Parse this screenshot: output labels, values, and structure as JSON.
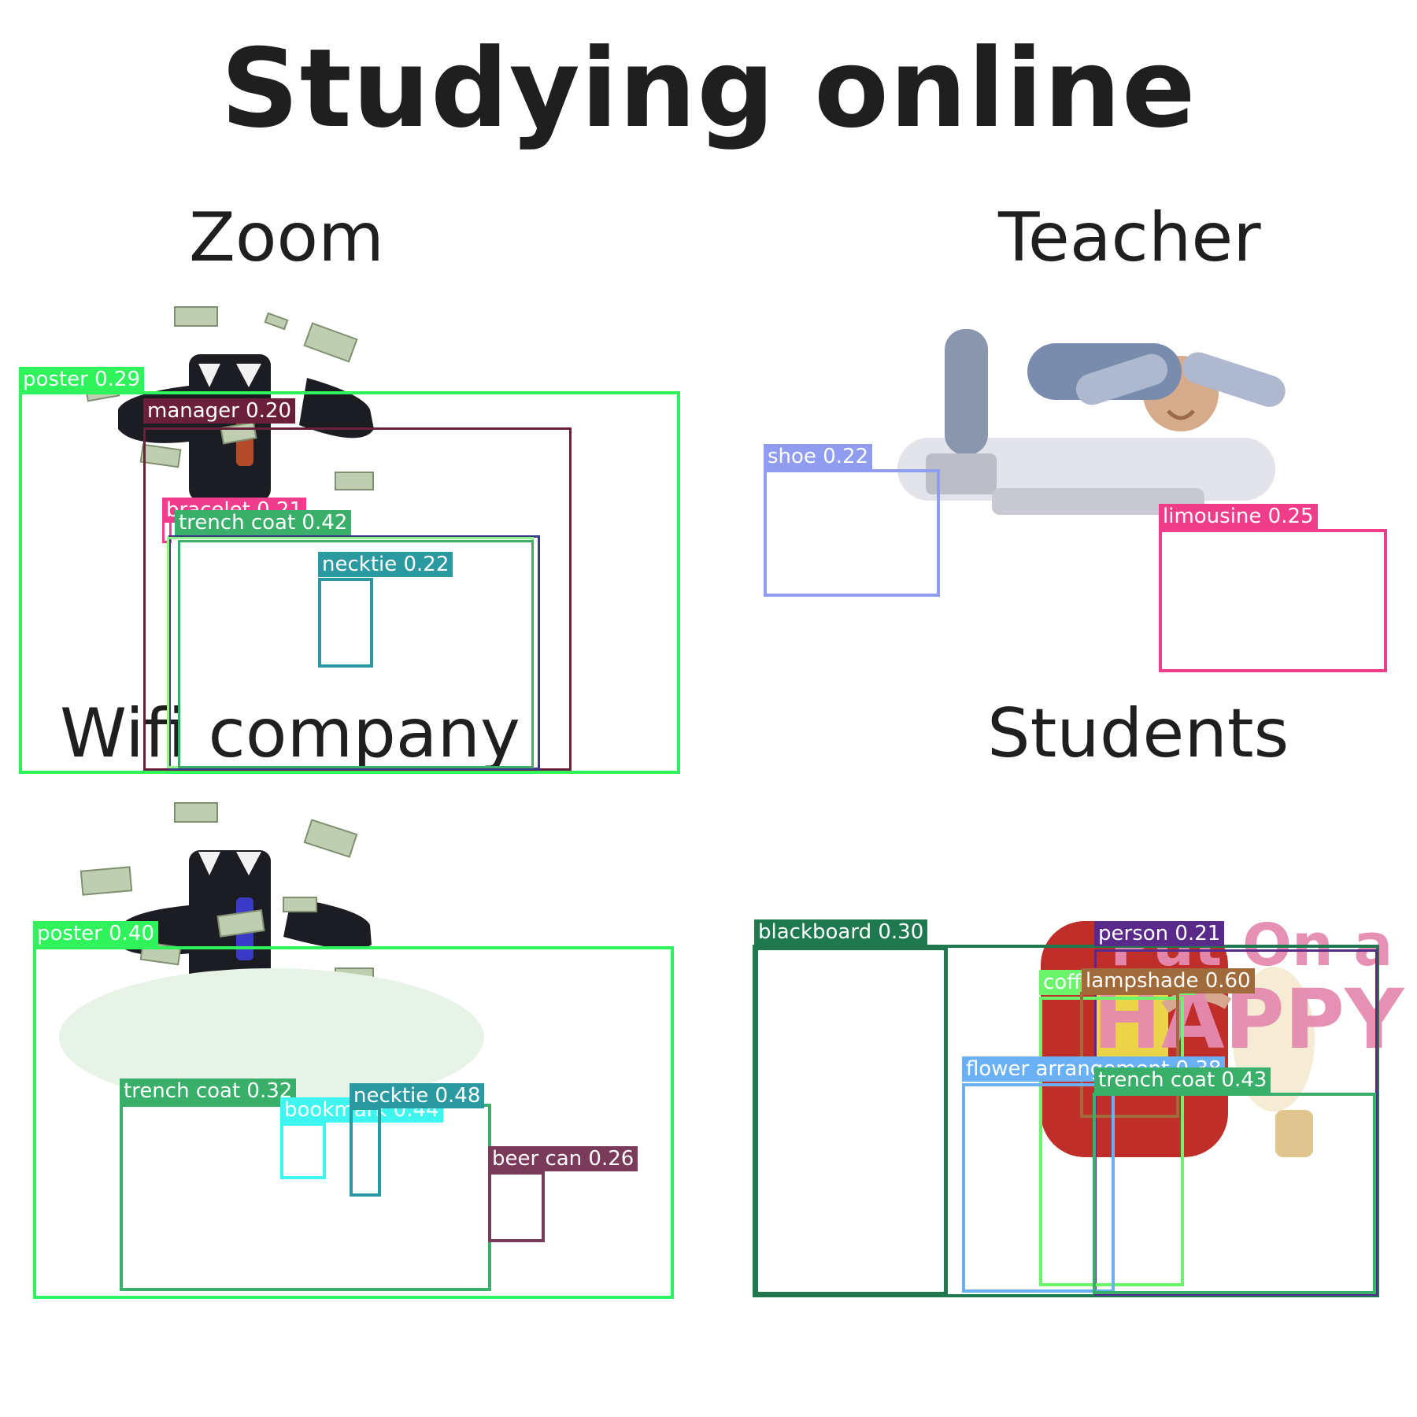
{
  "title": "Studying online",
  "panels": {
    "zoom": "Zoom",
    "teacher": "Teacher",
    "wifi": "Wifi company",
    "students": "Students"
  },
  "background_text": {
    "line1": "Put On a",
    "line2": "HAPPY"
  },
  "detections": {
    "zoom_poster": "poster 0.29",
    "zoom_manager": "manager 0.20",
    "zoom_bracelet": "bracelet 0.21",
    "zoom_trench_coat": "trench coat 0.42",
    "zoom_necktie": "necktie 0.22",
    "teacher_shoe": "shoe 0.22",
    "teacher_limousine": "limousine 0.25",
    "wifi_poster": "poster 0.40",
    "wifi_trench_coat": "trench coat 0.32",
    "wifi_bookmark": "bookmark 0.44",
    "wifi_necktie": "necktie 0.48",
    "wifi_beer_can": "beer can 0.26",
    "students_blackboard": "blackboard 0.30",
    "students_person": "person 0.21",
    "students_coffee": "coffeepot 0.41",
    "students_lampshade": "lampshade 0.60",
    "students_flower": "flower arrangement 0.38",
    "students_trench_coat": "trench coat 0.43"
  },
  "colors": {
    "poster": "#2ef35a",
    "manager": "#6b1f3a",
    "bracelet": "#f03c8c",
    "trench_coat": "#3aaf6a",
    "necktie": "#2a9aa0",
    "shoe": "#8f9cf0",
    "limousine": "#ef3d8a",
    "bookmark": "#3ff5f0",
    "beer_can": "#7a3a5a",
    "blackboard": "#1e7a4e",
    "person": "#5a2a8a",
    "coffeepot": "#6cf56c",
    "lampshade": "#a06a3a",
    "flower": "#6ab0f5"
  },
  "icons": [
    "businessman-with-money-icon",
    "sleeping-teacher-icon",
    "happy-character-icon"
  ]
}
